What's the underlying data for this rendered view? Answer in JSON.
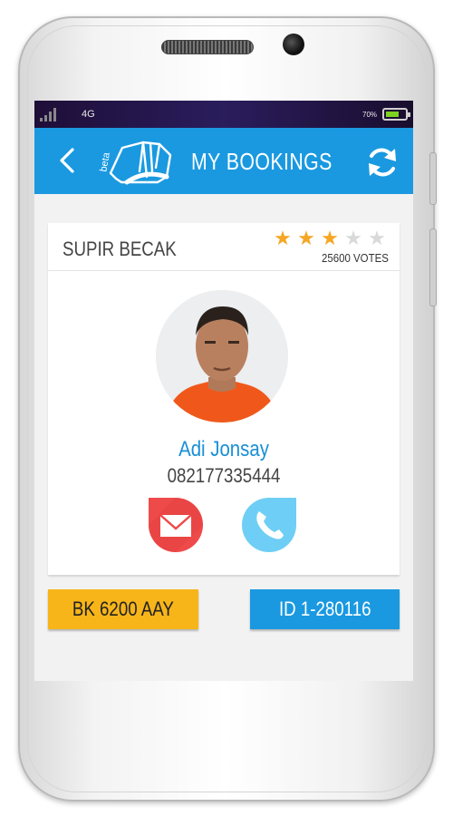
{
  "statusbar": {
    "network": "4G",
    "battery_pct": "70%",
    "battery_level": 0.7
  },
  "header": {
    "title": "MY BOOKINGS",
    "logo_tag": "beta"
  },
  "driver": {
    "type_label": "SUPIR BECAK",
    "rating": 3,
    "rating_max": 5,
    "votes_label": "25600 VOTES",
    "name": "Adi Jonsay",
    "phone": "082177335444"
  },
  "booking": {
    "plate": "BK 6200 AAY",
    "order_id": "ID 1-280116"
  },
  "colors": {
    "accent": "#1a99e0",
    "star_on": "#f5a623",
    "star_off": "#d9d9d9",
    "plate_bg": "#f7b519",
    "mail": "#ef4a4a",
    "call": "#6fcef5"
  },
  "icons": [
    "signal-icon",
    "battery-icon",
    "back-icon",
    "becak-logo-icon",
    "refresh-icon",
    "star-icon",
    "mail-icon",
    "phone-icon"
  ]
}
